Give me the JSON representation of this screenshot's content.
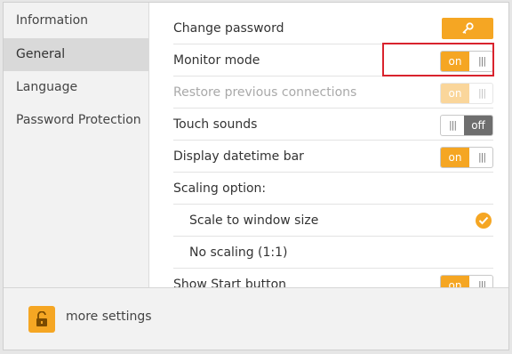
{
  "sidebar": {
    "items": [
      {
        "label": "Information"
      },
      {
        "label": "General"
      },
      {
        "label": "Language"
      },
      {
        "label": "Password Protection"
      }
    ]
  },
  "settings": {
    "change_password": "Change password",
    "monitor_mode": {
      "label": "Monitor mode",
      "state": "on"
    },
    "restore_connections": {
      "label": "Restore previous connections",
      "state": "on"
    },
    "touch_sounds": {
      "label": "Touch sounds",
      "state": "off"
    },
    "datetime_bar": {
      "label": "Display datetime bar",
      "state": "on"
    },
    "scaling_option": "Scaling option:",
    "scale_to_window": "Scale to window size",
    "no_scaling": "No scaling (1:1)",
    "start_button": {
      "label": "Show Start button",
      "state": "on"
    }
  },
  "toggle_text": {
    "on": "on",
    "off": "off",
    "grip": "|||"
  },
  "footer": {
    "more_settings": "more settings"
  },
  "colors": {
    "accent": "#f5a623",
    "highlight": "#d9232d",
    "off": "#6e6e6e"
  },
  "icons": [
    "key-icon",
    "check-icon",
    "unlock-icon"
  ]
}
